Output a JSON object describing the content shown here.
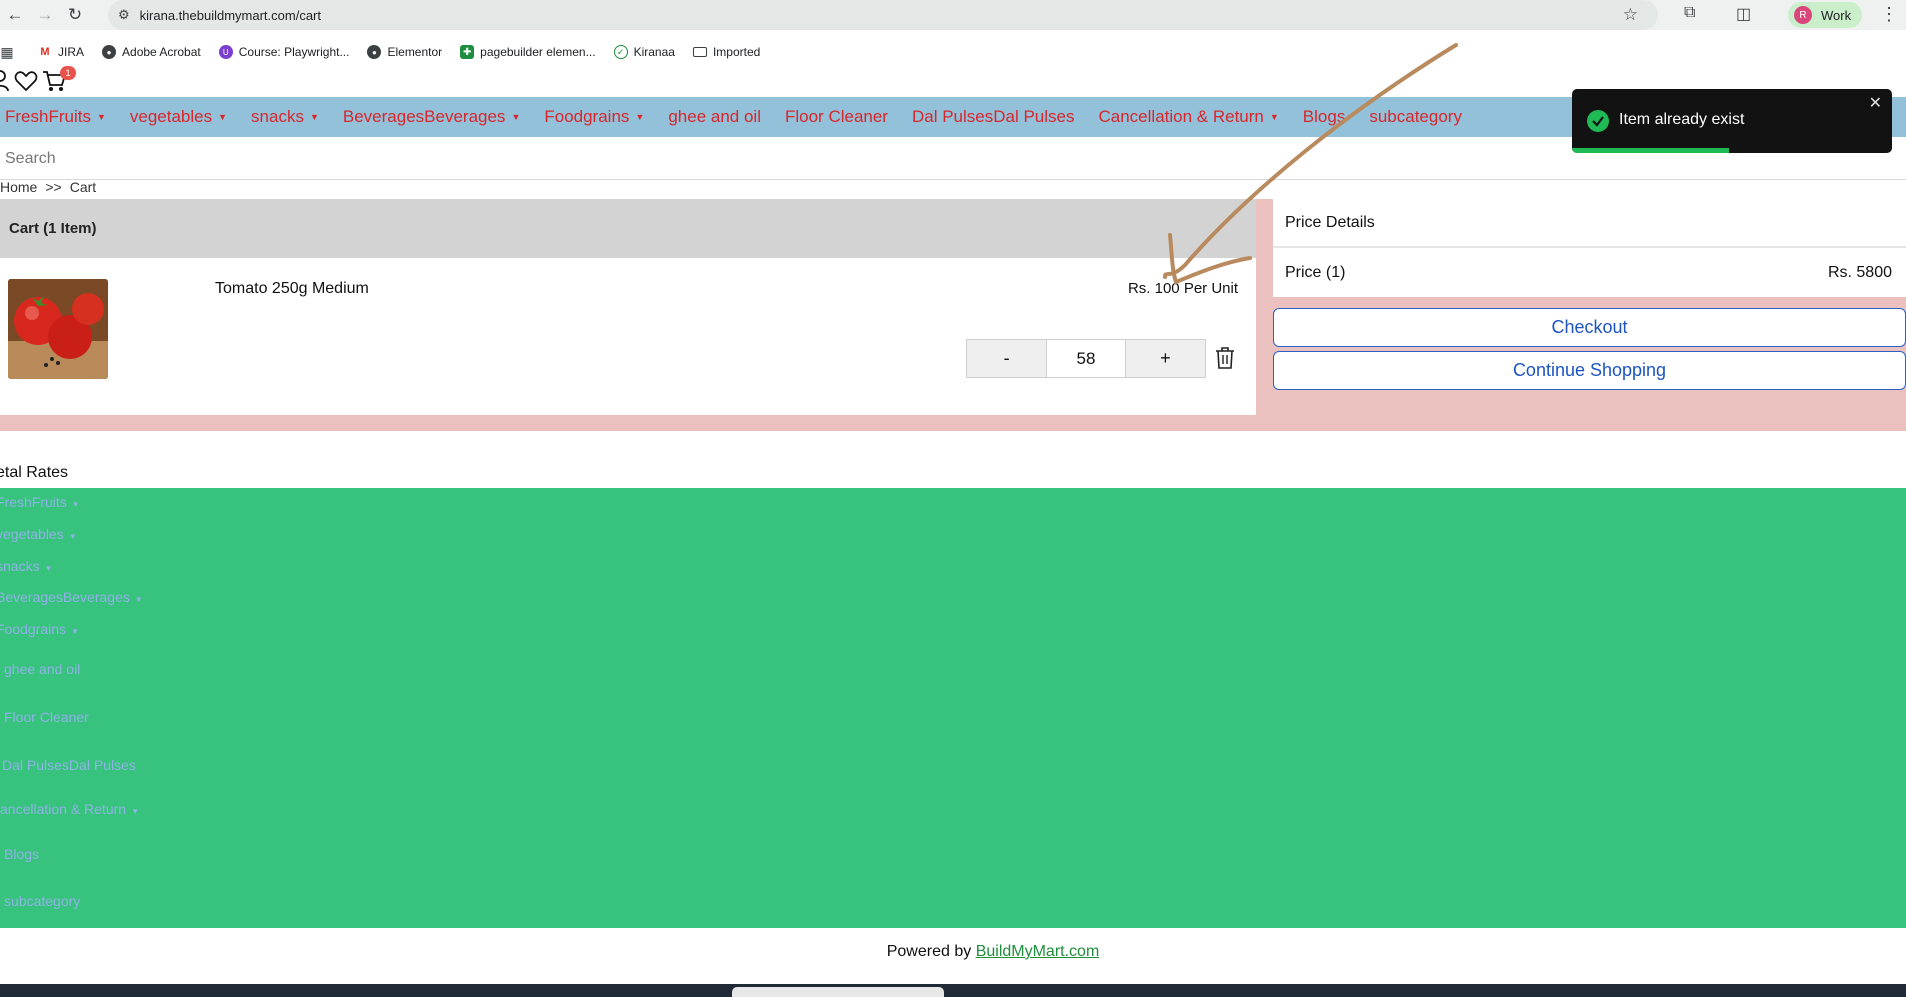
{
  "browser": {
    "url": "kirana.thebuildmymart.com/cart",
    "profile_initial": "R",
    "profile_label": "Work"
  },
  "bookmarks": [
    "JIRA",
    "Adobe Acrobat",
    "Course: Playwright...",
    "Elementor",
    "pagebuilder elemen...",
    "Kiranaa",
    "Imported"
  ],
  "header": {
    "cart_badge": "1"
  },
  "menu": [
    {
      "label": "FreshFruits",
      "has_dropdown": true
    },
    {
      "label": "vegetables",
      "has_dropdown": true
    },
    {
      "label": "snacks",
      "has_dropdown": true
    },
    {
      "label": "BeveragesBeverages",
      "has_dropdown": true
    },
    {
      "label": "Foodgrains",
      "has_dropdown": true
    },
    {
      "label": "ghee and oil",
      "has_dropdown": false
    },
    {
      "label": "Floor Cleaner",
      "has_dropdown": false
    },
    {
      "label": "Dal PulsesDal Pulses",
      "has_dropdown": false
    },
    {
      "label": "Cancellation & Return",
      "has_dropdown": true
    },
    {
      "label": "Blogs",
      "has_dropdown": false
    },
    {
      "label": "subcategory",
      "has_dropdown": false
    }
  ],
  "search": {
    "placeholder": "Search"
  },
  "breadcrumb": {
    "home": "Home",
    "separator": ">>",
    "current": "Cart"
  },
  "cart": {
    "header": "Cart (1 Item)",
    "item": {
      "name": "Tomato 250g Medium",
      "unit_price": "Rs. 100 Per Unit",
      "quantity": "58",
      "minus_label": "-",
      "plus_label": "+"
    }
  },
  "price_details": {
    "title": "Price Details",
    "price_label": "Price (1)",
    "price_value": "Rs. 5800",
    "checkout_label": "Checkout",
    "continue_label": "Continue Shopping"
  },
  "metal_rates": {
    "title": "etal Rates",
    "links": [
      "FreshFruits",
      "vegetables",
      "snacks",
      "BeveragesBeverages",
      "Foodgrains",
      "ghee and oil",
      "Floor Cleaner",
      "Dal PulsesDal Pulses",
      "ancellation & Return",
      "Blogs",
      "subcategory"
    ]
  },
  "footer": {
    "prefix": "Powered by",
    "link": "BuildMyMart.com"
  },
  "toast": {
    "message": "Item already exist",
    "close": "✕",
    "progress": 0.49
  },
  "colors": {
    "menu_bg": "#93c1da",
    "menu_text": "#d8262b",
    "cart_area_bg": "#ebc1c0",
    "green_bg": "#37c27d",
    "button_blue": "#1d54c2",
    "toast_bg": "#121212",
    "toast_accent": "#1fba55"
  }
}
